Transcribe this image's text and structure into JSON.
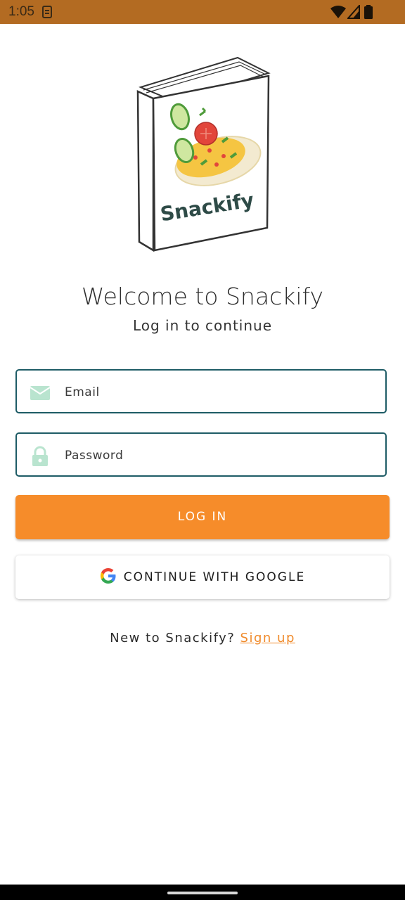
{
  "status_bar": {
    "time": "1:05",
    "sim_icon": "sim-card-icon",
    "icons": [
      "wifi-icon",
      "signal-icon",
      "battery-icon"
    ],
    "background": "#b36b22"
  },
  "illustration": {
    "icon": "snackify-book-logo",
    "brand_text": "Snackify"
  },
  "header": {
    "title": "Welcome to Snackify",
    "subtitle": "Log in to continue"
  },
  "form": {
    "email": {
      "placeholder": "Email",
      "value": "",
      "icon": "mail-icon"
    },
    "password": {
      "placeholder": "Password",
      "value": "",
      "icon": "lock-icon"
    },
    "login_label": "LOG IN",
    "google_label": "CONTINUE WITH GOOGLE",
    "google_icon": "google-icon"
  },
  "footer": {
    "prompt": "New to Snackify?",
    "signup_label": "Sign up"
  },
  "colors": {
    "accent": "#f68c2a",
    "field_border": "#1e5c66",
    "icon_tint": "#b9e4cf",
    "link": "#f08a2a"
  }
}
